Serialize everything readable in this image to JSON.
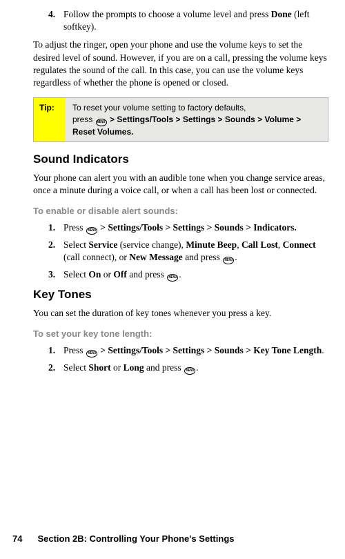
{
  "ok_label": "MENU/OK",
  "top_step": {
    "num": "4.",
    "prefix": "Follow the prompts to choose a volume level and press ",
    "bold": "Done",
    "suffix": " (left softkey)."
  },
  "ringer_para": "To adjust the ringer, open your phone and use the volume keys to set the desired level of sound. However, if you are on a call, pressing the volume keys regulates the sound of the call. In this case, you can use the volume keys regardless of whether the phone is opened or closed.",
  "tip": {
    "label": "Tip:",
    "line1": "To reset your volume setting to factory defaults,",
    "line2_prefix": "press ",
    "line2_bold": " > Settings/Tools > Settings > Sounds > Volume > Reset Volumes."
  },
  "sound_indicators": {
    "heading": "Sound Indicators",
    "intro": "Your phone can alert you with an audible tone when you change service areas, once a minute during a voice call, or when a call has been lost or connected.",
    "lead": "To enable or disable alert sounds:",
    "steps": [
      {
        "num": "1.",
        "prefix": "Press ",
        "bold_after_icon": " > Settings/Tools > Settings > Sounds > Indicators."
      },
      {
        "num": "2.",
        "t1": "Select ",
        "b1": "Service",
        "t2": " (service change), ",
        "b2": "Minute Beep",
        "t3": ", ",
        "b3": "Call Lost",
        "t4": ", ",
        "b4": "Connect",
        "t5": " (call connect), or ",
        "b5": "New Message",
        "t6": " and press ",
        "t7": "."
      },
      {
        "num": "3.",
        "t1": "Select ",
        "b1": "On",
        "t2": " or ",
        "b2": "Off",
        "t3": " and press ",
        "t4": "."
      }
    ]
  },
  "key_tones": {
    "heading": "Key Tones",
    "intro": "You can set the duration of key tones whenever you press a key.",
    "lead": "To set your key tone length:",
    "steps": [
      {
        "num": "1.",
        "prefix": "Press ",
        "bold_after_icon": " > Settings/Tools > Settings > Sounds > Key Tone Length",
        "suffix": "."
      },
      {
        "num": "2.",
        "t1": "Select ",
        "b1": "Short",
        "t2": " or ",
        "b2": "Long",
        "t3": " and press ",
        "t4": "."
      }
    ]
  },
  "footer": {
    "page": "74",
    "section": "Section 2B: Controlling Your Phone's Settings"
  }
}
